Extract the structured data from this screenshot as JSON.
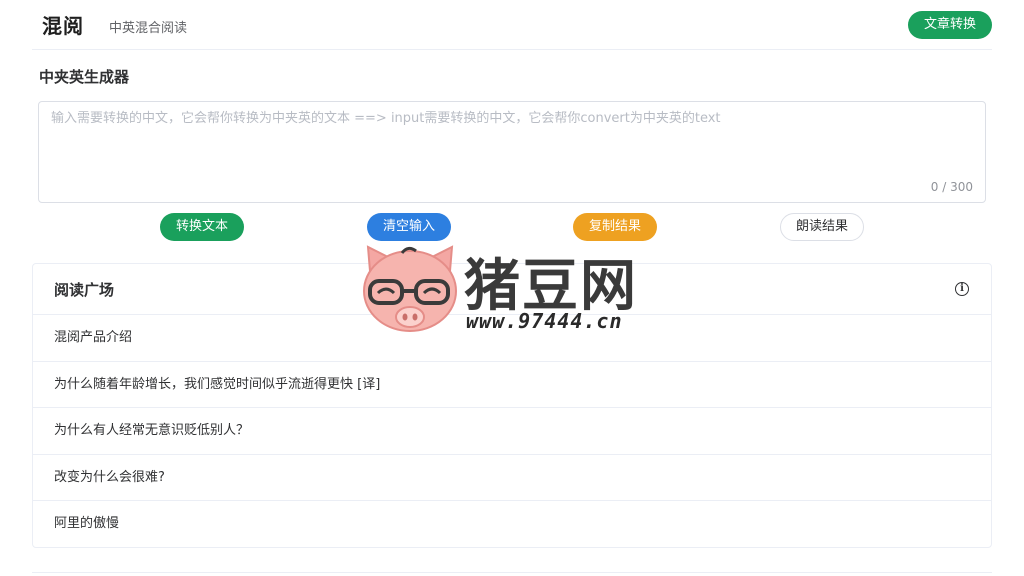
{
  "header": {
    "logo": "混阅",
    "tagline": "中英混合阅读",
    "article_convert_label": "文章转换"
  },
  "generator": {
    "title": "中夹英生成器",
    "input_value": "",
    "input_placeholder": "输入需要转换的中文，它会帮你转换为中夹英的文本 ==> input需要转换的中文，它会帮你convert为中夹英的text",
    "char_count": "0 / 300",
    "buttons": {
      "convert": "转换文本",
      "clear": "清空输入",
      "copy": "复制结果",
      "read": "朗读结果"
    }
  },
  "plaza": {
    "title": "阅读广场",
    "info_icon": "info-icon",
    "items": [
      "混阅产品介绍",
      "为什么随着年龄增长，我们感觉时间似乎流逝得更快 [译]",
      "为什么有人经常无意识贬低别人？",
      "改变为什么会很难?",
      "阿里的傲慢"
    ]
  },
  "watermark": {
    "text": "猪豆网",
    "url": "www.97444.cn"
  },
  "colors": {
    "green": "#1aa05c",
    "blue": "#2d7fe0",
    "orange": "#eea121",
    "border": "#ebeef5"
  }
}
